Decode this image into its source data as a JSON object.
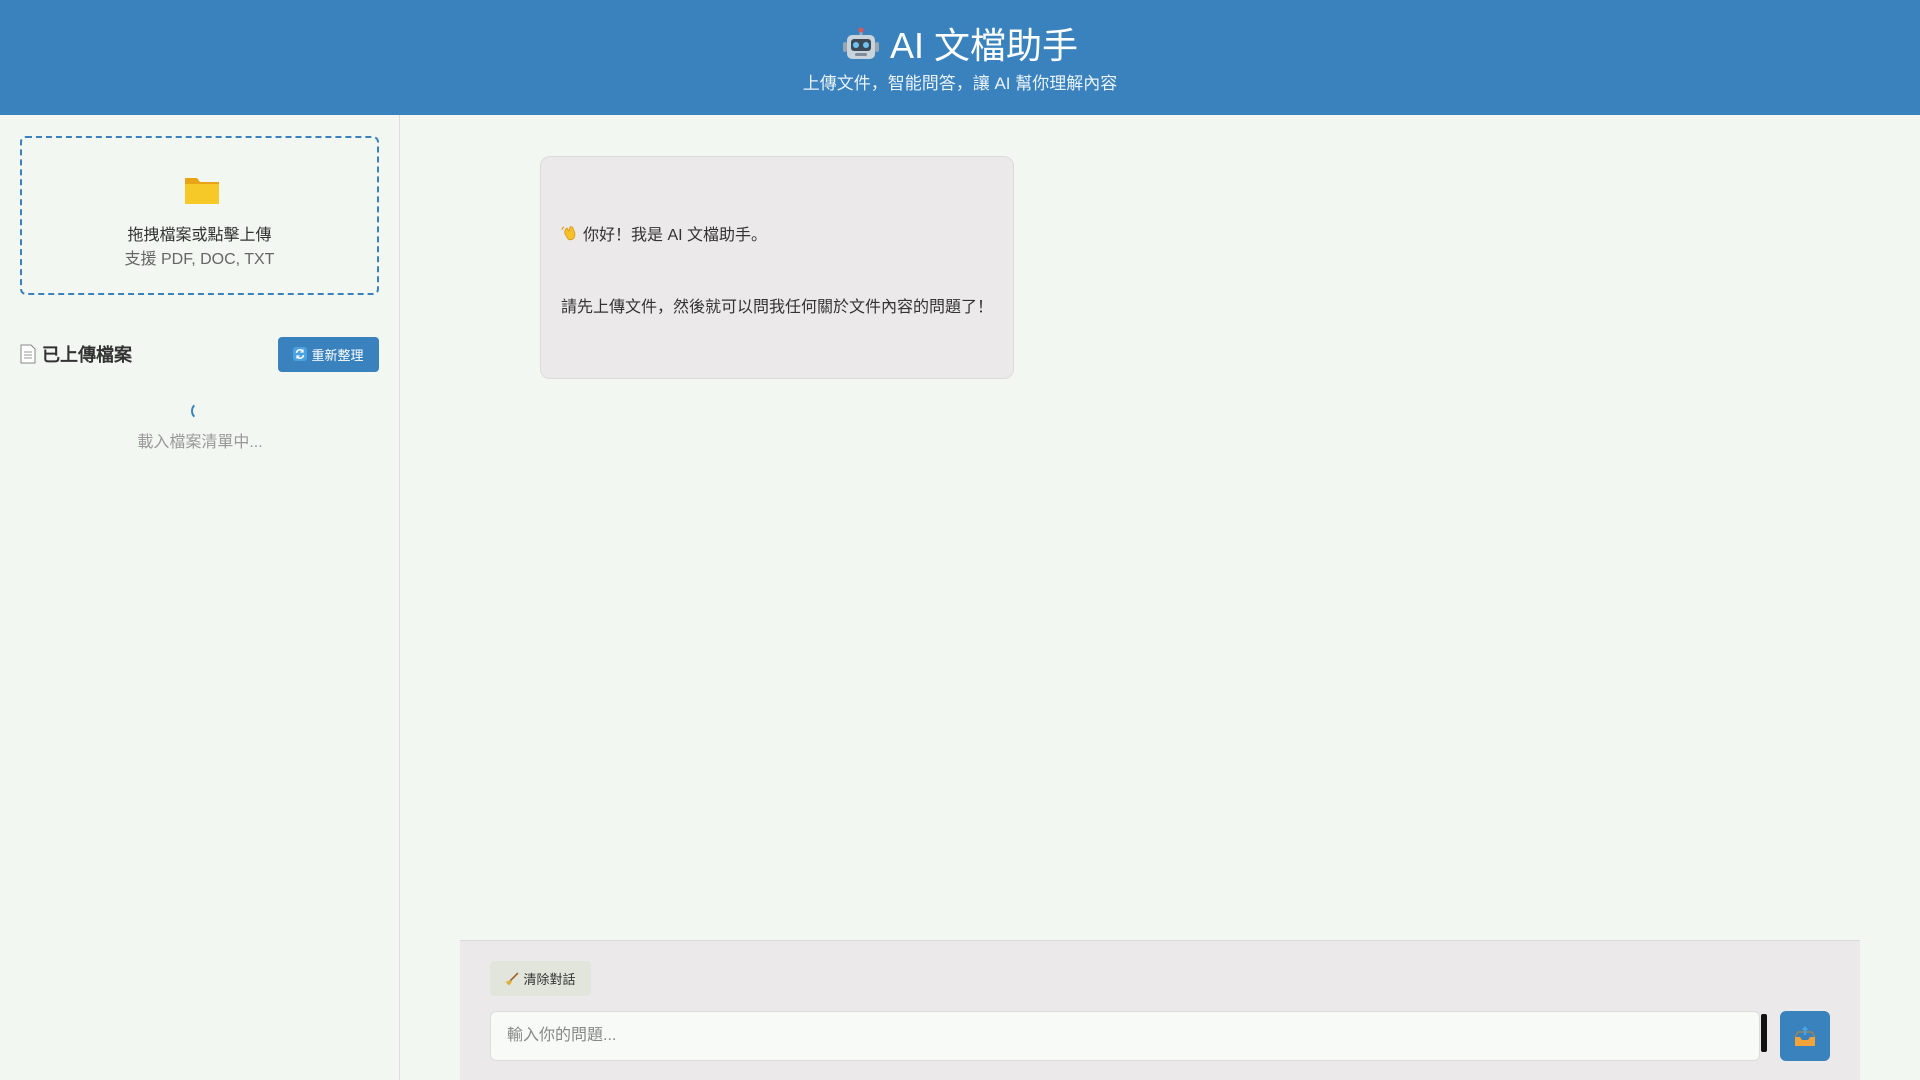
{
  "header": {
    "icon": "robot-icon",
    "title": "AI 文檔助手",
    "subtitle": "上傳文件，智能問答，讓 AI 幫你理解內容"
  },
  "sidebar": {
    "upload": {
      "icon": "folder-icon",
      "title": "拖拽檔案或點擊上傳",
      "formats": "支援 PDF, DOC, TXT"
    },
    "files": {
      "icon": "document-icon",
      "title": "已上傳檔案",
      "refresh_label": "重新整理",
      "refresh_icon": "refresh-icon",
      "loading_text": "載入檔案清單中..."
    }
  },
  "chat": {
    "messages": [
      {
        "role": "bot",
        "icon": "waving-hand-icon",
        "line1": "你好！我是 AI 文檔助手。",
        "line2": "請先上傳文件，然後就可以問我任何關於文件內容的問題了！"
      }
    ]
  },
  "input_area": {
    "clear_label": "清除對話",
    "clear_icon": "broom-icon",
    "placeholder": "輸入你的問題...",
    "value": "",
    "send_icon": "send-icon"
  },
  "colors": {
    "primary": "#3a82bd",
    "background": "#f2f7f2",
    "bubble": "#ebe9e9"
  }
}
